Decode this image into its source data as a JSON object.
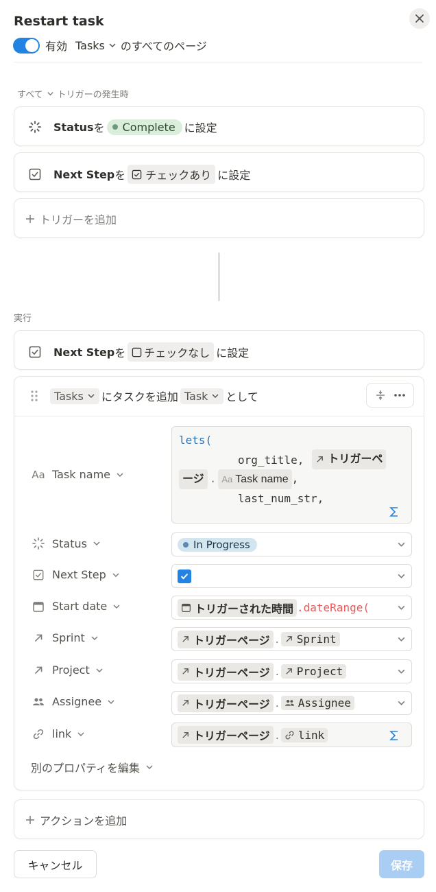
{
  "header": {
    "title": "Restart task",
    "toggle_label": "有効",
    "database": "Tasks",
    "scope_suffix": "のすべてのページ"
  },
  "triggers": {
    "section_label": "すべて",
    "section_suffix": "トリガーの発生時",
    "items": [
      {
        "prop": "Status",
        "particle": "を",
        "value": "Complete",
        "value_color": "#6c9b7d",
        "suffix": "に設定"
      },
      {
        "prop": "Next Step",
        "particle": "を",
        "value": "チェックあり",
        "suffix": "に設定"
      }
    ],
    "add_label": "トリガーを追加"
  },
  "actions": {
    "section_label": "実行",
    "set_item": {
      "prop": "Next Step",
      "particle": "を",
      "value": "チェックなし",
      "suffix": "に設定"
    },
    "add_task": {
      "db": "Tasks",
      "middle": "にタスクを追加",
      "type": "Task",
      "suffix": "として"
    },
    "properties": {
      "task_name": {
        "label": "Task name",
        "code_line1": "lets(",
        "code_line2_var": "org_title,",
        "code_chip_trigger": "トリガーペ",
        "code_chip_trigger_cont": "ージ",
        "code_chip_prop": "Task name",
        "code_comma": ",",
        "code_line4": "last_num_str,"
      },
      "status": {
        "label": "Status",
        "value": "In Progress",
        "value_color": "#5e87b5"
      },
      "next_step": {
        "label": "Next Step",
        "checked": true
      },
      "start_date": {
        "label": "Start date",
        "chip": "トリガーされた時間",
        "func": ".dateRange("
      },
      "sprint": {
        "label": "Sprint",
        "chip": "トリガーページ",
        "prop": "Sprint"
      },
      "project": {
        "label": "Project",
        "chip": "トリガーページ",
        "prop": "Project"
      },
      "assignee": {
        "label": "Assignee",
        "chip": "トリガーページ",
        "prop": "Assignee"
      },
      "link": {
        "label": "link",
        "chip": "トリガーページ",
        "prop": "link"
      }
    },
    "edit_other_label": "別のプロパティを編集",
    "add_label": "アクションを追加"
  },
  "footer": {
    "cancel_label": "キャンセル",
    "save_label": "保存"
  },
  "colors": {
    "accent": "#2383e2",
    "save_disabled": "#a9cdf3",
    "function_red": "#eb5757"
  }
}
